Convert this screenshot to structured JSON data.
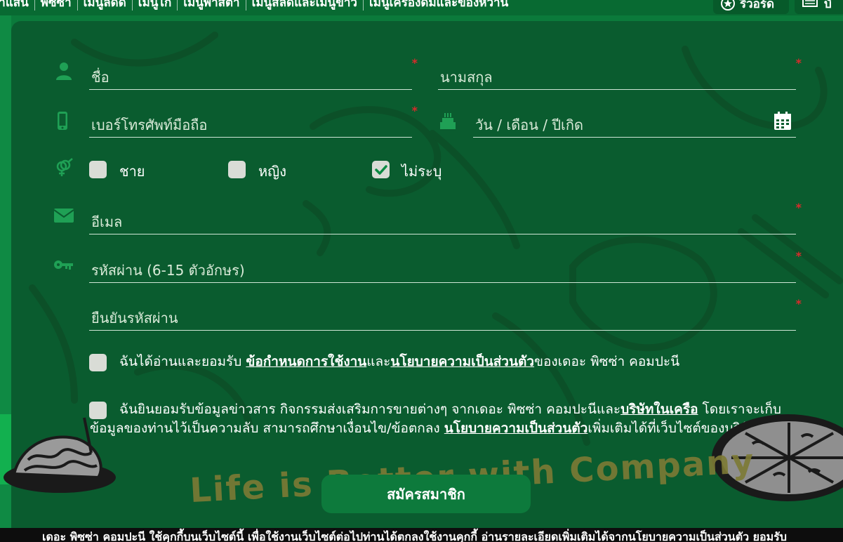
{
  "nav": {
    "menu_items": [
      "ูกำแสน",
      "พิซซ่า",
      "เมนูลัดดี",
      "เมนูไก่",
      "เมนูพาสต้า",
      "เมนูสลัดและเมนูข้าว",
      "เมนูเครื่องดื่มและของหวาน"
    ],
    "rewards_label": "รีวอร์ด",
    "cart_label": "บั"
  },
  "form": {
    "first_name": {
      "placeholder": "ชื่อ",
      "required_mark": "*"
    },
    "last_name": {
      "placeholder": "นามสกุล",
      "required_mark": "*"
    },
    "phone": {
      "placeholder": "เบอร์โทรศัพท์มือถือ",
      "required_mark": "*"
    },
    "birthday": {
      "placeholder": "วัน / เดือน / ปีเกิด"
    },
    "gender": {
      "options": [
        {
          "label": "ชาย",
          "checked": false
        },
        {
          "label": "หญิง",
          "checked": false
        },
        {
          "label": "ไม่ระบุ",
          "checked": true
        }
      ]
    },
    "email": {
      "placeholder": "อีเมล",
      "required_mark": "*"
    },
    "password": {
      "placeholder": "รหัสผ่าน  (6-15 ตัวอักษร)",
      "required_mark": "*"
    },
    "confirm_password": {
      "placeholder": "ยืนยันรหัสผ่าน",
      "required_mark": "*"
    }
  },
  "consent_terms": {
    "prefix": "ฉันได้อ่านและยอมรับ ",
    "terms_link": "ข้อกำหนดการใช้งาน",
    "and": "และ",
    "privacy_link": "นโยบายความเป็นส่วนตัว",
    "suffix": "ของเดอะ พิซซ่า คอมปะนี"
  },
  "consent_marketing": {
    "prefix": "ฉันยินยอมรับข้อมูลข่าวสาร กิจกรรมส่งเสริมการขายต่างๆ จากเดอะ พิซซ่า คอมปะนีและ",
    "affiliates_link": "บริษัทในเครือ",
    "middle": " โดยเราจะเก็บข้อมูลของท่านไว้เป็นความลับ สามารถศึกษาเงื่อนไข/ข้อตกลง ",
    "privacy_link": "นโยบายความเป็นส่วนตัว",
    "suffix": "เพิ่มเติมได้ที่เว็บไซต์ของบริษัทฯ"
  },
  "slogan": "Life is Better with Company",
  "submit_label": "สมัครสมาชิก",
  "cookie_notice": "เดอะ พิซซ่า คอมปะนี ใช้คุกกี้บนเว็บไซต์นี้ เพื่อใช้งานเว็บไซต์ต่อไปท่านได้ตกลงใช้งานคุกกี้ อ่านรายละเอียดเพิ่มเติมได้จากนโยบายความเป็นส่วนตัว ยอมรับ",
  "colors": {
    "brand_green": "#0b7a3b",
    "panel_green": "#0a5c2f",
    "required_red": "#d92b2b"
  }
}
